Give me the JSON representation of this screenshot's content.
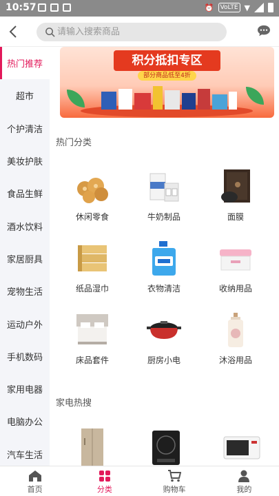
{
  "status_bar": {
    "time": "10:57",
    "network_badge": "VoLTE"
  },
  "header": {
    "search_placeholder": "请输入搜索商品"
  },
  "sidebar": {
    "items": [
      {
        "label": "热门推荐",
        "active": true
      },
      {
        "label": "超市"
      },
      {
        "label": "个护清洁"
      },
      {
        "label": "美妆护肤"
      },
      {
        "label": "食品生鲜"
      },
      {
        "label": "酒水饮料"
      },
      {
        "label": "家居厨具"
      },
      {
        "label": "宠物生活"
      },
      {
        "label": "运动户外"
      },
      {
        "label": "手机数码"
      },
      {
        "label": "家用电器"
      },
      {
        "label": "电脑办公"
      },
      {
        "label": "汽车生活"
      }
    ]
  },
  "banner": {
    "title": "积分抵扣专区",
    "subtitle": "部分商品低至4折"
  },
  "hot_categories": {
    "title": "热门分类",
    "items": [
      {
        "label": "休闲零食",
        "icon": "snack-icon"
      },
      {
        "label": "牛奶制品",
        "icon": "milk-icon"
      },
      {
        "label": "面膜",
        "icon": "facemask-icon"
      },
      {
        "label": "纸品湿巾",
        "icon": "tissue-icon"
      },
      {
        "label": "衣物清洁",
        "icon": "detergent-icon"
      },
      {
        "label": "收纳用品",
        "icon": "storage-box-icon"
      },
      {
        "label": "床品套件",
        "icon": "bed-icon"
      },
      {
        "label": "厨房小电",
        "icon": "hotpot-icon"
      },
      {
        "label": "沐浴用品",
        "icon": "body-wash-icon"
      }
    ]
  },
  "appliance_hot": {
    "title": "家电热搜"
  },
  "bottom_nav": {
    "items": [
      {
        "label": "首页",
        "icon": "home-icon"
      },
      {
        "label": "分类",
        "icon": "category-icon",
        "active": true
      },
      {
        "label": "购物车",
        "icon": "cart-icon"
      },
      {
        "label": "我的",
        "icon": "user-icon"
      }
    ]
  },
  "colors": {
    "accent": "#e2195a",
    "sidebar_bg": "#f4f5f9",
    "status_bar_bg": "#8a8a8a"
  }
}
